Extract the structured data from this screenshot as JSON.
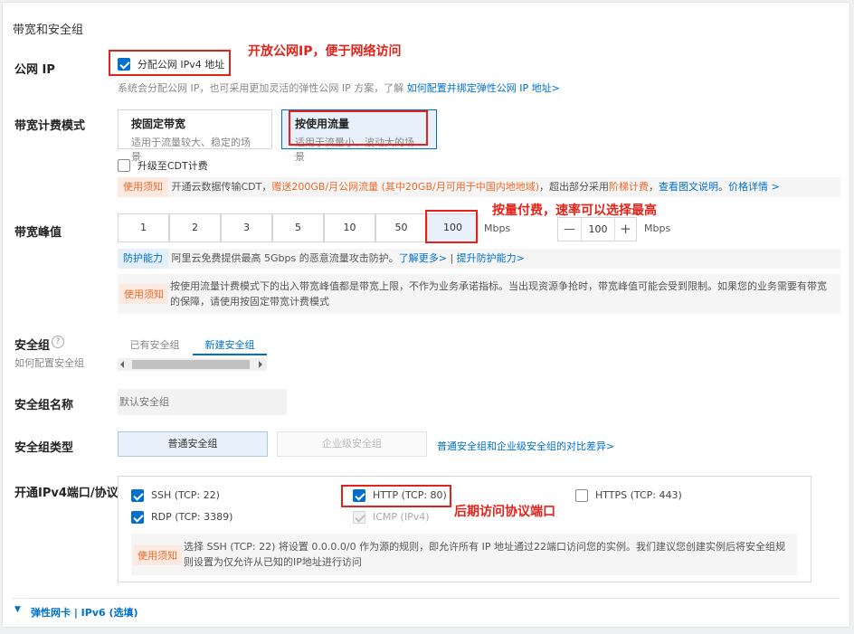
{
  "section_title": "带宽和安全组",
  "public_ip": {
    "label": "公网 IP",
    "checkbox_label": "分配公网 IPv4 地址",
    "checked": true,
    "hint": "系统会分配公网 IP，也可采用更加灵活的弹性公网 IP 方案，了解",
    "hint_link": "如何配置并绑定弹性公网 IP 地址>"
  },
  "billing": {
    "label": "带宽计费模式",
    "options": [
      {
        "title": "按固定带宽",
        "desc": "适用于流量较大、稳定的场景",
        "selected": false
      },
      {
        "title": "按使用流量",
        "desc": "适用于流量小、波动大的场景",
        "selected": true
      }
    ],
    "cdt_label": "升级至CDT计费",
    "notice": {
      "tag": "使用须知",
      "text1": "开通云数据传输CDT，",
      "text2": "赠送200GB/月公网流量 (其中20GB/月可用于中国内地地域)",
      "text3": "，超出部分采用",
      "text4": "阶梯计费",
      "text5": "，",
      "link1": "查看图文说明",
      "text6": "。",
      "link2": "价格详情 >"
    }
  },
  "bandwidth": {
    "label": "带宽峰值",
    "options": [
      "1",
      "2",
      "3",
      "5",
      "10",
      "50",
      "100"
    ],
    "selected": "100",
    "unit": "Mbps",
    "stepper_value": "100",
    "stepper_minus": "—",
    "stepper_plus": "+",
    "stepper_unit": "Mbps",
    "protection": {
      "tag": "防护能力",
      "text": "阿里云免费提供最高 5Gbps 的恶意流量攻击防护。",
      "link1": "了解更多>",
      "sep": "|",
      "link2": "提升防护能力>"
    },
    "notice": {
      "tag": "使用须知",
      "text": "按使用流量计费模式下的出入带宽峰值都是带宽上限，不作为业务承诺指标。当出现资源争抢时，带宽峰值可能会受到限制。如果您的业务需要有带宽的保障，请使用按固定带宽计费模式"
    }
  },
  "security_group": {
    "label": "安全组",
    "help_icon": "?",
    "sub_link": "如何配置安全组",
    "tabs": [
      {
        "label": "已有安全组",
        "active": false
      },
      {
        "label": "新建安全组",
        "active": true
      }
    ]
  },
  "sg_name": {
    "label": "安全组名称",
    "placeholder": "默认安全组"
  },
  "sg_type": {
    "label": "安全组类型",
    "options": [
      {
        "label": "普通安全组",
        "selected": true,
        "disabled": false
      },
      {
        "label": "企业级安全组",
        "selected": false,
        "disabled": true
      }
    ],
    "link": "普通安全组和企业级安全组的对比差异>"
  },
  "ports": {
    "label": "开通IPv4端口/协议",
    "items": [
      {
        "label": "SSH (TCP:  22)",
        "checked": true,
        "disabled": false
      },
      {
        "label": "HTTP (TCP:  80)",
        "checked": true,
        "disabled": false
      },
      {
        "label": "HTTPS (TCP:  443)",
        "checked": false,
        "disabled": false
      },
      {
        "label": "RDP (TCP:  3389)",
        "checked": true,
        "disabled": false
      },
      {
        "label": "ICMP  (IPv4)",
        "checked": true,
        "disabled": true
      }
    ],
    "notice": {
      "tag": "使用须知",
      "text": "选择 SSH (TCP:  22) 将设置 0.0.0.0/0 作为源的规则，即允许所有 IP 地址通过22端口访问您的实例。我们建议您创建实例后将安全组规则设置为仅允许从已知的IP地址进行访问"
    }
  },
  "footer": {
    "expand_icon": "▼",
    "label": "弹性网卡 | IPv6 (选填)"
  },
  "annotations": {
    "note1": "开放公网IP，便于网络访问",
    "note2": "按量付费，速率可以选择最高",
    "note3": "后期访问协议端口"
  },
  "colors": {
    "accent": "#0070cc",
    "annotation_red": "#e2231a",
    "warning_orange": "#f06a2a"
  }
}
